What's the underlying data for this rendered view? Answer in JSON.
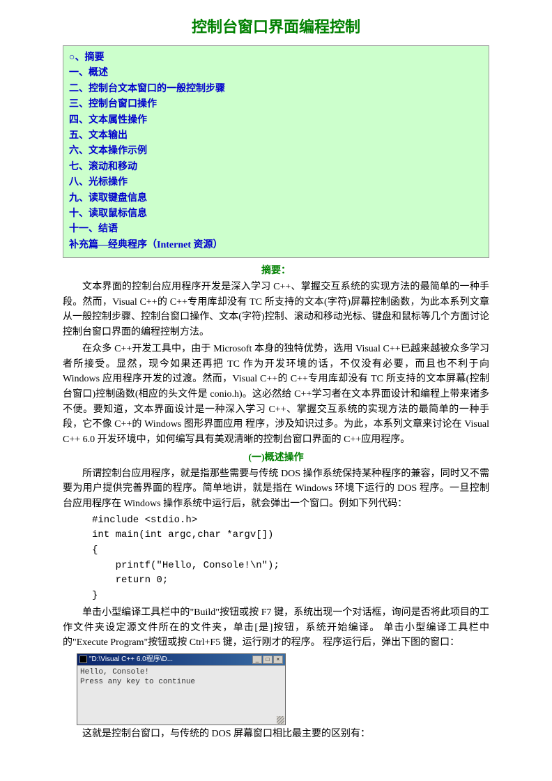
{
  "title": "控制台窗口界面编程控制",
  "toc": [
    "○、摘要",
    "一、概述",
    "二、控制台文本窗口的一般控制步骤",
    "三、控制台窗口操作",
    "四、文本属性操作",
    "五、文本输出",
    "六、文本操作示例",
    "七、滚动和移动",
    "八、光标操作",
    "九、读取键盘信息",
    "十、读取鼠标信息",
    "十一、结语",
    "补充篇—经典程序（Internet 资源）"
  ],
  "abstract_label": "摘要：",
  "abstract_p1": "文本界面的控制台应用程序开发是深入学习 C++、掌握交互系统的实现方法的最简单的一种手段。然而，Visual C++的 C++专用库却没有 TC 所支持的文本(字符)屏幕控制函数，为此本系列文章从一般控制步骤、控制台窗口操作、文本(字符)控制、滚动和移动光标、键盘和鼠标等几个方面讨论控制台窗口界面的编程控制方法。",
  "abstract_p2": "在众多 C++开发工具中，由于 Microsoft 本身的独特优势，选用 Visual C++已越来越被众多学习者所接受。显然，现今如果还再把 TC 作为开发环境的话，不仅没有必要，而且也不利于向 Windows 应用程序开发的过渡。然而，Visual C++的 C++专用库却没有 TC 所支持的文本屏幕(控制台窗口)控制函数(相应的头文件是 conio.h)。这必然给 C++学习者在文本界面设计和编程上带来诸多不便。要知道，文本界面设计是一种深入学习 C++、掌握交互系统的实现方法的最简单的一种手段，它不像 C++的 Windows 图形界面应用 程序，涉及知识过多。为此，本系列文章来讨论在 Visual C++ 6.0 开发环境中，如何编写具有美观清晰的控制台窗口界面的 C++应用程序。",
  "section1_label": "(一)概述操作",
  "section1_p1": "所谓控制台应用程序，就是指那些需要与传统 DOS 操作系统保持某种程序的兼容，同时又不需要为用户提供完善界面的程序。简单地讲，就是指在 Windows 环境下运行的 DOS 程序。一旦控制台应用程序在 Windows 操作系统中运行后，就会弹出一个窗口。例如下列代码：",
  "code": "#include <stdio.h>\nint main(int argc,char *argv[])\n{\n    printf(\"Hello, Console!\\n\");\n    return 0;\n}",
  "section1_p2": "单击小型编译工具栏中的\"Build\"按钮或按 F7 键，系统出现一个对话框，询问是否将此项目的工作文件夹设定源文件所在的文件夹，单击[是]按钮，系统开始编译。 单击小型编译工具栏中的\"Execute Program\"按钮或按 Ctrl+F5 键，运行刚才的程序。 程序运行后，弹出下图的窗口：",
  "console": {
    "title": "\"D:\\Visual C++ 6.0程序\\D...",
    "body": "Hello, Console!\nPress any key to continue",
    "btn_min": "_",
    "btn_max": "□",
    "btn_close": "×"
  },
  "section1_p3": "这就是控制台窗口，与传统的 DOS 屏幕窗口相比最主要的区别有："
}
